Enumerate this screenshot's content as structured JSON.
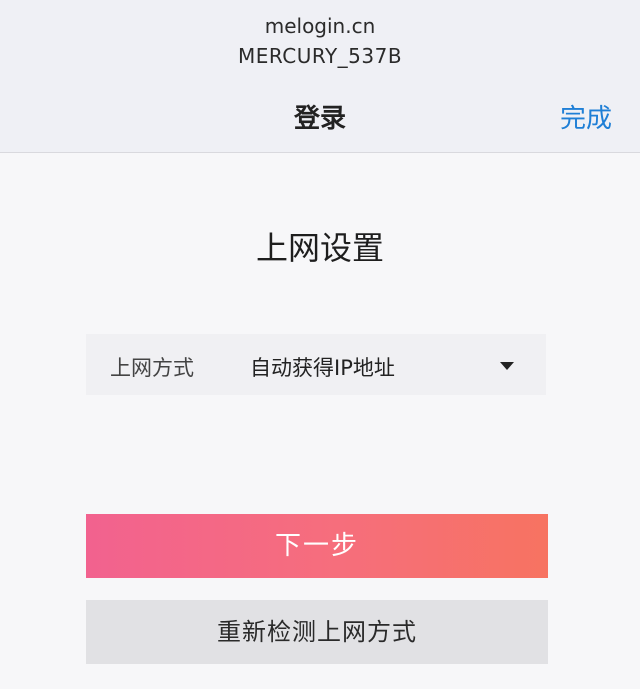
{
  "header": {
    "url": "melogin.cn",
    "ssid": "MERCURY_537B",
    "title": "登录",
    "done_label": "完成"
  },
  "main": {
    "page_title": "上网设置",
    "mode_field": {
      "label": "上网方式",
      "selected_value": "自动获得IP地址",
      "icon": "chevron-down-icon"
    },
    "next_button_label": "下一步",
    "redetect_button_label": "重新检测上网方式"
  },
  "colors": {
    "accent_blue": "#1f7fd6",
    "next_button_gradient_start": "#f2628f",
    "next_button_gradient_end": "#f77361",
    "secondary_button": "#e1e1e4"
  }
}
